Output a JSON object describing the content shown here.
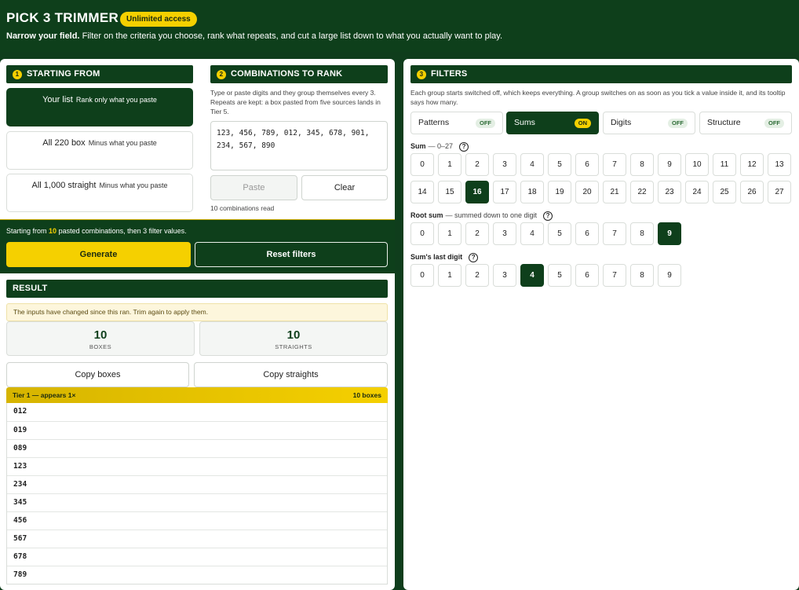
{
  "header": {
    "title": "PICK 3 TRIMMER",
    "badge": "Unlimited access",
    "tagline_bold": "Narrow your field.",
    "tagline_rest": "Filter on the criteria you choose, rank what repeats, and cut a large list down to what you actually want to play."
  },
  "starting": {
    "num": "1",
    "heading": "STARTING FROM",
    "options": [
      {
        "label": "Your list",
        "sub": "Rank only what you paste",
        "selected": true
      },
      {
        "label": "All 220 box",
        "sub": "Minus what you paste",
        "selected": false
      },
      {
        "label": "All 1,000 straight",
        "sub": "Minus what you paste",
        "selected": false
      }
    ]
  },
  "combos": {
    "num": "2",
    "heading": "COMBINATIONS TO RANK",
    "description": "Type or paste digits and they group themselves every 3. Repeats are kept: a box pasted from five sources lands in Tier 5.",
    "textarea_value": "123, 456, 789, 012, 345, 678, 901,\n234, 567, 890",
    "paste_label": "Paste",
    "clear_label": "Clear",
    "count_text": "10 combinations read"
  },
  "action": {
    "info_prefix": "Starting from",
    "info_count": "10",
    "info_suffix": "pasted combinations, then 3 filter values.",
    "generate_label": "Generate",
    "reset_label": "Reset filters"
  },
  "result": {
    "heading": "RESULT",
    "warning": "The inputs have changed since this ran. Trim again to apply them.",
    "boxes_value": "10",
    "boxes_label": "BOXES",
    "straights_value": "10",
    "straights_label": "STRAIGHTS",
    "copy_boxes_label": "Copy boxes",
    "copy_straights_label": "Copy straights",
    "tier_label": "Tier 1 — appears 1×",
    "tier_count": "10 boxes",
    "rows": [
      "012",
      "019",
      "089",
      "123",
      "234",
      "345",
      "456",
      "567",
      "678",
      "789"
    ]
  },
  "filters": {
    "num": "3",
    "heading": "FILTERS",
    "description": "Each group starts switched off, which keeps everything. A group switches on as soon as you tick a value inside it, and its tooltip says how many.",
    "toggles": [
      {
        "label": "Patterns",
        "state": "OFF",
        "on": false
      },
      {
        "label": "Sums",
        "state": "ON",
        "on": true
      },
      {
        "label": "Digits",
        "state": "OFF",
        "on": false
      },
      {
        "label": "Structure",
        "state": "OFF",
        "on": false
      }
    ],
    "sum": {
      "label": "Sum",
      "sub": "— 0–27",
      "help": "?",
      "values": [
        "0",
        "1",
        "2",
        "3",
        "4",
        "5",
        "6",
        "7",
        "8",
        "9",
        "10",
        "11",
        "12",
        "13",
        "14",
        "15",
        "16",
        "17",
        "18",
        "19",
        "20",
        "21",
        "22",
        "23",
        "24",
        "25",
        "26",
        "27"
      ],
      "selected": [
        "16"
      ]
    },
    "root_sum": {
      "label": "Root sum",
      "sub": "— summed down to one digit",
      "help": "?",
      "values": [
        "0",
        "1",
        "2",
        "3",
        "4",
        "5",
        "6",
        "7",
        "8",
        "9"
      ],
      "selected": [
        "9"
      ]
    },
    "last_digit": {
      "label": "Sum's last digit",
      "sub": "",
      "help": "?",
      "values": [
        "0",
        "1",
        "2",
        "3",
        "4",
        "5",
        "6",
        "7",
        "8",
        "9"
      ],
      "selected": [
        "4"
      ]
    }
  },
  "colors": {
    "brand_green": "#0e3f1b",
    "accent_yellow": "#f5d000"
  }
}
